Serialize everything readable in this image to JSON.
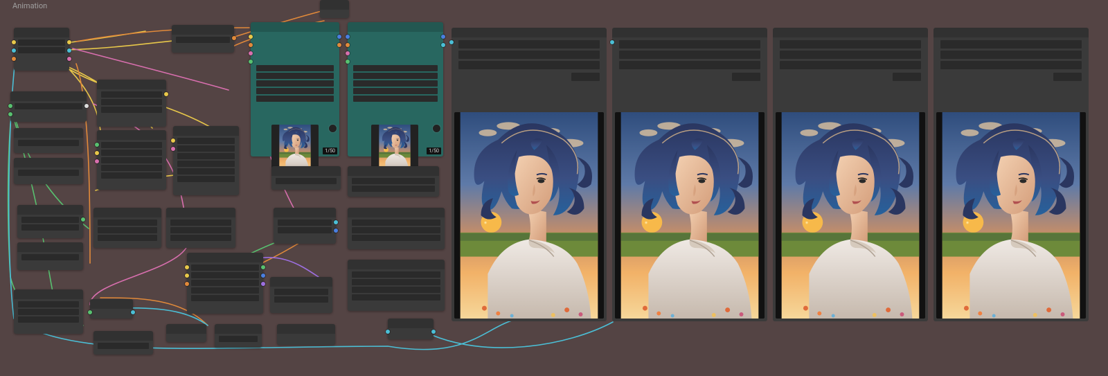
{
  "workspace": {
    "label": "Animation"
  },
  "previews": {
    "badge": "1/50"
  },
  "colors": {
    "yellow": "#e8c84a",
    "orange": "#e28a3a",
    "green": "#58c170",
    "cyan": "#4bbfd6",
    "blue": "#4a7fe0",
    "pink": "#d86fae",
    "purple": "#9d6fe0",
    "white": "#dcdcdc"
  }
}
